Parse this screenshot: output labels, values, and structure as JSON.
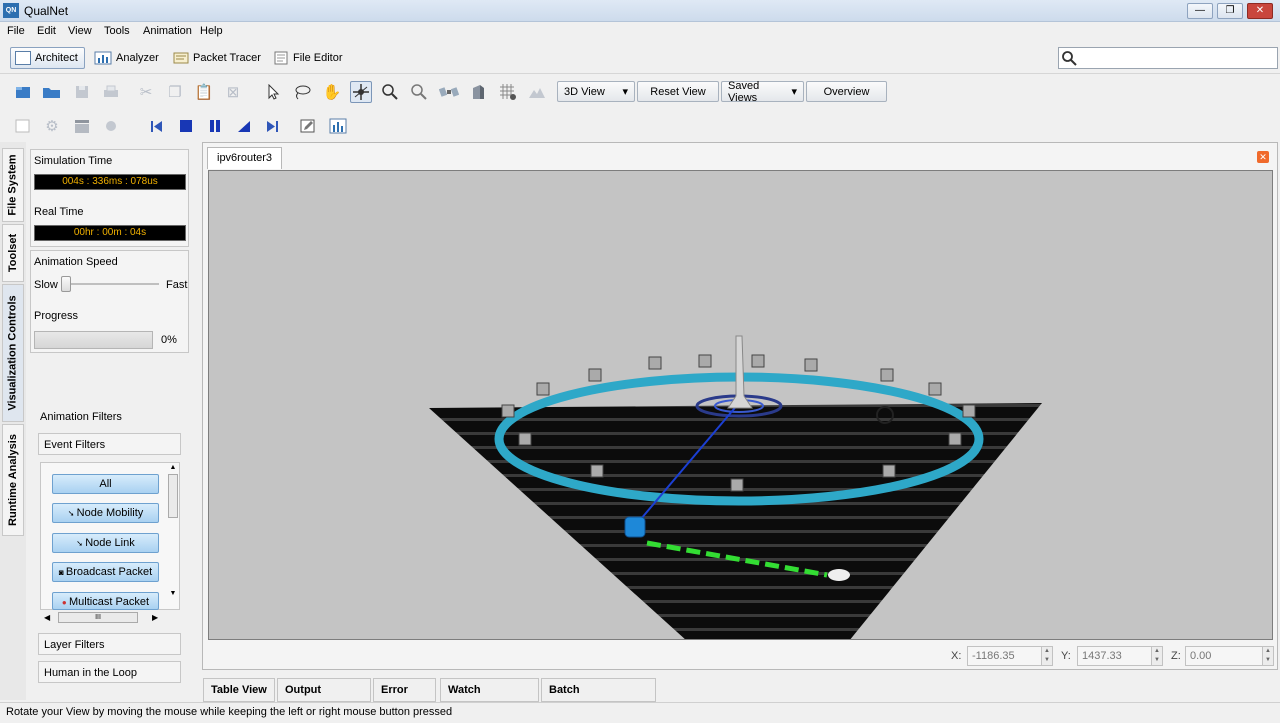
{
  "window": {
    "title": "QualNet",
    "logo_text": "QN",
    "minimize": "—",
    "maximize": "❐",
    "close": "✕"
  },
  "menu": [
    "File",
    "Edit",
    "View",
    "Tools",
    "Animation",
    "Help"
  ],
  "modes": {
    "architect": "Architect",
    "analyzer": "Analyzer",
    "packet_tracer": "Packet Tracer",
    "file_editor": "File Editor"
  },
  "search": {
    "placeholder": ""
  },
  "view_toolbar": {
    "view_select": "3D View",
    "reset_view": "Reset View",
    "saved_views": "Saved Views",
    "overview": "Overview"
  },
  "left_tabs": [
    "File System",
    "Toolset",
    "Visualization Controls",
    "Runtime Analysis"
  ],
  "viz": {
    "sim_time_label": "Simulation Time",
    "sim_time_value": "004s : 336ms : 078us",
    "real_time_label": "Real Time",
    "real_time_value": "00hr : 00m : 04s",
    "speed_label": "Animation Speed",
    "slow": "Slow",
    "fast": "Fast",
    "progress_label": "Progress",
    "progress_value": "0%",
    "progress_fraction": 0,
    "animation_filters": "Animation Filters",
    "event_filters": "Event Filters",
    "filters": [
      "All",
      "Node Mobility",
      "Node Link",
      "Broadcast Packet",
      "Multicast Packet"
    ],
    "scroll_h": "III",
    "layer_filters": "Layer Filters",
    "hitl": "Human in the Loop"
  },
  "canvas_tab": "ipv6router3",
  "coords": {
    "x_label": "X:",
    "x": "-1186.35",
    "y_label": "Y:",
    "y": "1437.33",
    "z_label": "Z:",
    "z": "0.00"
  },
  "bottom_tabs": [
    "Table View",
    "Output Window",
    "Error Log",
    "Watch Variables",
    "Batch Experiments"
  ],
  "status": "Rotate your View by moving the mouse while keeping the left or right mouse button pressed",
  "colors": {
    "accent": "#2d6fb0",
    "ring": "#2ea8c8",
    "link": "#33dd33",
    "lcd_text": "#f0b000"
  }
}
